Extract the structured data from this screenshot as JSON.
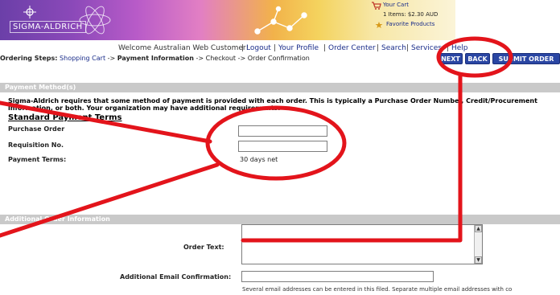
{
  "banner": {
    "logo_text": "SIGMA-ALDRICH",
    "cart_link": "Your Cart",
    "cart_items": "1 Items: $2.30 AUD",
    "favorites_link": "Favorite Products"
  },
  "topnav": {
    "welcome": "Welcome Australian Web Customer!",
    "separator": "|",
    "links": [
      "Logout",
      "Your Profile",
      "Order Center",
      "Search",
      "Services",
      "Help"
    ]
  },
  "steps": {
    "label": "Ordering Steps:",
    "arrow": "->",
    "items": [
      "Shopping Cart",
      "Payment Information",
      "Checkout",
      "Order Confirmation"
    ]
  },
  "buttons": {
    "next": "NEXT",
    "back": "BACK",
    "submit": "SUBMIT ORDER"
  },
  "payment": {
    "section_title": "Payment Method(s)",
    "description_line1": "Sigma-Aldrich requires that some method of payment is provided with each order. This is typically a Purchase Order Number, Credit/Procurement",
    "description_line2": "information, or both. Your organization may have additional requirements.",
    "standard_terms": "Standard Payment Terms",
    "purchase_order_label": "Purchase Order",
    "purchase_order_value": "",
    "requisition_label": "Requisition No.",
    "requisition_value": "",
    "payment_terms_label": "Payment Terms:",
    "payment_terms_value": "30 days net"
  },
  "additional": {
    "section_title": "Additional Order Information",
    "order_text_label": "Order Text:",
    "order_text_value": "",
    "email_label": "Additional Email Confirmation:",
    "email_value": "",
    "email_help": "Several email addresses can be entered in this filed. Separate multiple email addresses with co"
  },
  "colors": {
    "annotation": "#e3141b",
    "button_blue": "#2a46a3",
    "section_gray": "#c9c9c9",
    "link_blue": "#1a2d8a"
  }
}
